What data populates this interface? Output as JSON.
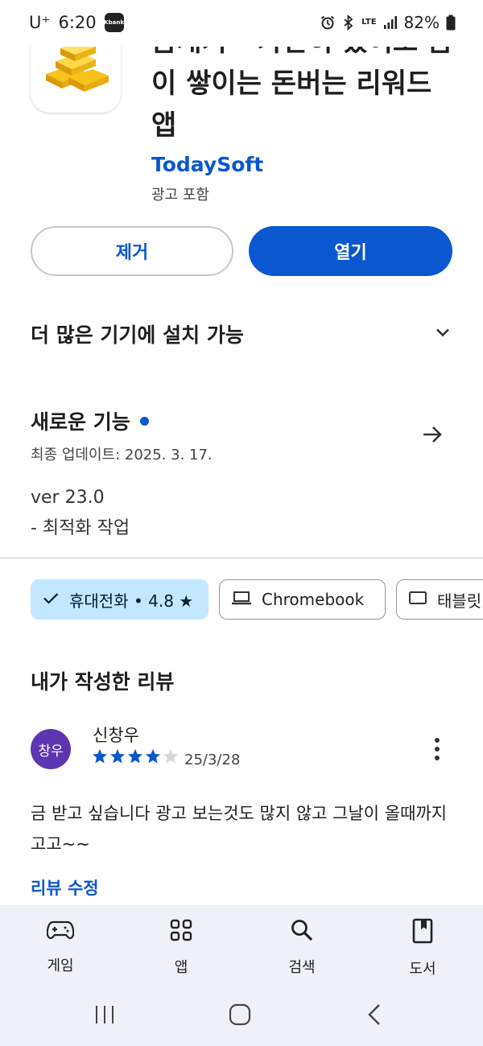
{
  "status_bar": {
    "carrier": "U⁺",
    "time": "6:20",
    "kbank_label": "Kbank",
    "network": "LTE",
    "battery": "82%"
  },
  "app": {
    "title": "금캐기 - 가만히 있어도 금이 쌓이는 돈버는 리워드 앱",
    "developer": "TodaySoft",
    "ads_note": "광고 포함",
    "icon": "gold-bars-icon"
  },
  "actions": {
    "uninstall_label": "제거",
    "open_label": "열기"
  },
  "more_devices": {
    "label": "더 많은 기기에 설치 가능"
  },
  "whats_new": {
    "title": "새로운 기능",
    "last_updated": "최종 업데이트: 2025. 3. 17.",
    "version": "ver 23.0",
    "note": "- 최적화 작업"
  },
  "device_chips": [
    {
      "label": "휴대전화 • 4.8 ★",
      "selected": true,
      "icon": "check-icon"
    },
    {
      "label": "Chromebook",
      "selected": false,
      "icon": "laptop-icon"
    },
    {
      "label": "태블릿",
      "selected": false,
      "icon": "tablet-icon"
    }
  ],
  "my_review": {
    "section_title": "내가 작성한 리뷰",
    "avatar_text": "창우",
    "reviewer_name": "신창우",
    "rating": 4,
    "max_rating": 5,
    "date": "25/3/28",
    "text": "금 받고 싶습니다 광고 보는것도 많지 않고 그날이 올때까지 고고~~",
    "edit_label": "리뷰 수정"
  },
  "bottom_nav": [
    {
      "label": "게임",
      "icon": "gamepad-icon"
    },
    {
      "label": "앱",
      "icon": "apps-grid-icon"
    },
    {
      "label": "검색",
      "icon": "search-icon"
    },
    {
      "label": "도서",
      "icon": "book-icon"
    }
  ],
  "colors": {
    "accent": "#0b57d0",
    "chip_selected_bg": "#c2e7ff",
    "nav_bg": "#eef1f8",
    "avatar_bg": "#5e35b1"
  }
}
